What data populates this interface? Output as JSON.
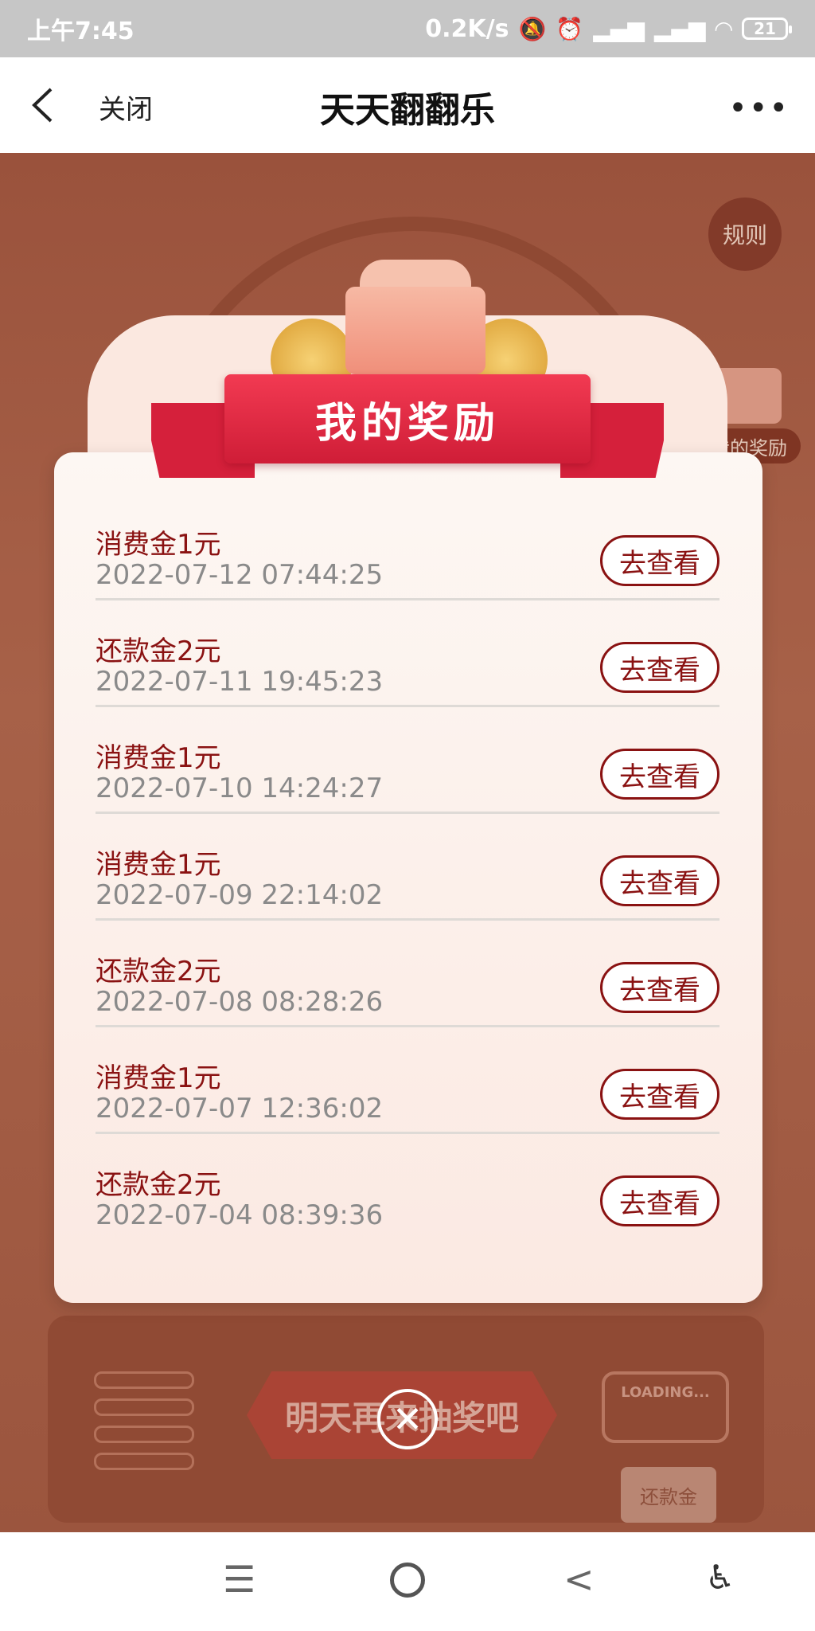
{
  "status_bar": {
    "time": "上午7:45",
    "speed": "0.2K/s",
    "battery": "21"
  },
  "nav": {
    "close_label": "关闭",
    "title": "天天翻翻乐",
    "more": "•••"
  },
  "background": {
    "rules_label": "规则",
    "my_rewards_side": "我的奖励",
    "lottery_button": "明天再来抽奖吧",
    "loading_label": "LOADING...",
    "ticket_label": "还款金"
  },
  "modal": {
    "title": "我的奖励",
    "items": [
      {
        "name": "消费金1元",
        "time": "2022-07-12 07:44:25",
        "action": "去查看"
      },
      {
        "name": "还款金2元",
        "time": "2022-07-11 19:45:23",
        "action": "去查看"
      },
      {
        "name": "消费金1元",
        "time": "2022-07-10 14:24:27",
        "action": "去查看"
      },
      {
        "name": "消费金1元",
        "time": "2022-07-09 22:14:02",
        "action": "去查看"
      },
      {
        "name": "还款金2元",
        "time": "2022-07-08 08:28:26",
        "action": "去查看"
      },
      {
        "name": "消费金1元",
        "time": "2022-07-07 12:36:02",
        "action": "去查看"
      },
      {
        "name": "还款金2元",
        "time": "2022-07-04 08:39:36",
        "action": "去查看"
      }
    ]
  },
  "colors": {
    "accent_red": "#d5203b",
    "text_dark_red": "#8a1212",
    "background_brown": "#b3634a"
  },
  "icons": {
    "back": "chevron-left-icon",
    "more": "more-dots-icon",
    "close": "close-icon",
    "menu": "menu-icon",
    "home": "home-icon",
    "back_sys": "back-triangle-icon",
    "accessibility": "accessibility-icon"
  }
}
